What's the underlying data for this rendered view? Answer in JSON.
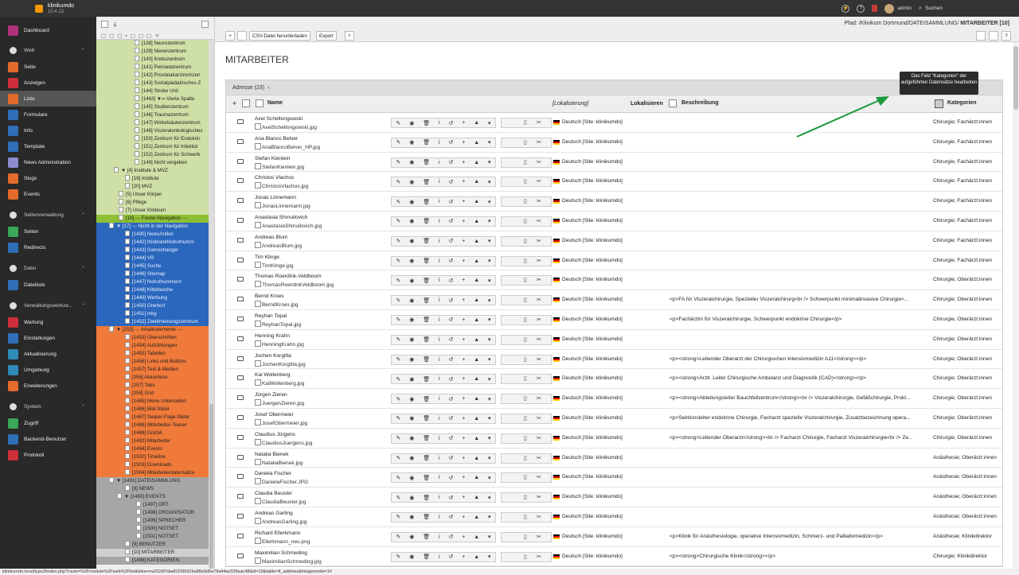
{
  "app": {
    "name": "klinikumdo",
    "version": "10.4.13",
    "user": "admin",
    "search_label": "Suchen"
  },
  "modules": [
    {
      "label": "Dashboard",
      "color": "#b0327d",
      "group": false
    },
    {
      "label": "Web",
      "color": "",
      "group": true
    },
    {
      "label": "Seite",
      "color": "#e46b2c",
      "group": false
    },
    {
      "label": "Anzeigen",
      "color": "#ce2f3a",
      "group": false
    },
    {
      "label": "Liste",
      "color": "#e46b2c",
      "group": false,
      "active": true
    },
    {
      "label": "Formulare",
      "color": "#2e6fb8",
      "group": false
    },
    {
      "label": "Info",
      "color": "#2e6fb8",
      "group": false
    },
    {
      "label": "Template",
      "color": "#2e6fb8",
      "group": false
    },
    {
      "label": "News Administration",
      "color": "#8b8ccf",
      "group": false
    },
    {
      "label": "Slugs",
      "color": "#e46b2c",
      "group": false
    },
    {
      "label": "Events",
      "color": "#e46b2c",
      "group": false
    },
    {
      "label": "Seitenverwaltung",
      "color": "",
      "group": true
    },
    {
      "label": "Seiten",
      "color": "#3aa858",
      "group": false
    },
    {
      "label": "Redirects",
      "color": "#2e6fb8",
      "group": false
    },
    {
      "label": "Datei",
      "color": "",
      "group": true
    },
    {
      "label": "Dateiliste",
      "color": "#2e6fb8",
      "group": false
    },
    {
      "label": "Verwaltungswerkze...",
      "color": "",
      "group": true
    },
    {
      "label": "Wartung",
      "color": "#ce2f3a",
      "group": false
    },
    {
      "label": "Einstellungen",
      "color": "#2e6fb8",
      "group": false
    },
    {
      "label": "Aktualisierung",
      "color": "#2e8bb8",
      "group": false
    },
    {
      "label": "Umgebung",
      "color": "#2e8bb8",
      "group": false
    },
    {
      "label": "Erweiterungen",
      "color": "#e46b2c",
      "group": false
    },
    {
      "label": "System",
      "color": "",
      "group": true
    },
    {
      "label": "Zugriff",
      "color": "#3aa858",
      "group": false
    },
    {
      "label": "Backend-Benutzer",
      "color": "#2e6fb8",
      "group": false
    },
    {
      "label": "Protokoll",
      "color": "#ce2f3a",
      "group": false
    }
  ],
  "tree": [
    {
      "t": "[138] Neurozentrum",
      "i": 48,
      "c": "#cfe0a6"
    },
    {
      "t": "[139] Nierenzentrum",
      "i": 48,
      "c": "#cfe0a6"
    },
    {
      "t": "[140] Krebszentrum",
      "i": 48,
      "c": "#cfe0a6"
    },
    {
      "t": "[141] Perinatalzentrum",
      "i": 48,
      "c": "#cfe0a6"
    },
    {
      "t": "[142] Prostatakarzinomzen",
      "i": 48,
      "c": "#cfe0a6"
    },
    {
      "t": "[143] Sozialpädiatrisches Z",
      "i": 48,
      "c": "#cfe0a6"
    },
    {
      "t": "[144] Stroke Unit",
      "i": 48,
      "c": "#cfe0a6"
    },
    {
      "t": "[1463] ▼═ Vierte Spalte",
      "i": 48,
      "c": "#cfe0a6"
    },
    {
      "t": "[145] Studienzentrum",
      "i": 48,
      "c": "#cfe0a6"
    },
    {
      "t": "[146] Traumazentrum",
      "i": 48,
      "c": "#cfe0a6"
    },
    {
      "t": "[147] Wirbelsäulenzentrum",
      "i": 48,
      "c": "#cfe0a6"
    },
    {
      "t": "[148] Viszeralonkologisches",
      "i": 48,
      "c": "#cfe0a6"
    },
    {
      "t": "[150] Zentrum für Endokrin",
      "i": 48,
      "c": "#cfe0a6"
    },
    {
      "t": "[151] Zentrum für Infektiol",
      "i": 48,
      "c": "#cfe0a6"
    },
    {
      "t": "[152] Zentrum für Schwerb",
      "i": 48,
      "c": "#cfe0a6"
    },
    {
      "t": "[149] Nicht vergeben",
      "i": 48,
      "c": "#cfe0a6"
    },
    {
      "t": "▼ [4] Institute & MVZ",
      "i": 22,
      "c": "#cfe0a6"
    },
    {
      "t": "[19] Institute",
      "i": 36,
      "c": "#cfe0a6"
    },
    {
      "t": "[20] MVZ",
      "i": 36,
      "c": "#cfe0a6"
    },
    {
      "t": "[5] Unser Körper",
      "i": 28,
      "c": "#cfe0a6"
    },
    {
      "t": "[6] Pflege",
      "i": 28,
      "c": "#cfe0a6"
    },
    {
      "t": "[7] Unser Klinikum",
      "i": 28,
      "c": "#cfe0a6"
    },
    {
      "t": "[18] --- Footer-Navigation ---",
      "i": 28,
      "c": "#8fbf34"
    },
    {
      "t": "▼ [17] --- Nicht in der Navigation",
      "i": 16,
      "c": "#2b67bd"
    },
    {
      "t": "[1490] NewsArtikel",
      "i": 36,
      "c": "#2b67bd"
    },
    {
      "t": "[1442] thinktankNotrufnumm",
      "i": 36,
      "c": "#2b67bd"
    },
    {
      "t": "[1443] Gamechanger",
      "i": 36,
      "c": "#2b67bd"
    },
    {
      "t": "[1444] VR",
      "i": 36,
      "c": "#2b67bd"
    },
    {
      "t": "[1445] Suche",
      "i": 36,
      "c": "#2b67bd"
    },
    {
      "t": "[1446] Sitemap",
      "i": 36,
      "c": "#2b67bd"
    },
    {
      "t": "[1447] Notrufnummern",
      "i": 36,
      "c": "#2b67bd"
    },
    {
      "t": "[1448] Kitteltasche",
      "i": 36,
      "c": "#2b67bd"
    },
    {
      "t": "[1449] Werbung",
      "i": 36,
      "c": "#2b67bd"
    },
    {
      "t": "[1450] Onehort",
      "i": 36,
      "c": "#2b67bd"
    },
    {
      "t": "[1451] mkg",
      "i": 36,
      "c": "#2b67bd"
    },
    {
      "t": "[1452] Zweitmeinungszentrum",
      "i": 36,
      "c": "#2b67bd"
    },
    {
      "t": "▼ [255] --- Inhaltselemente ---",
      "i": 16,
      "c": "#f07a3a"
    },
    {
      "t": "[1453] Überschriften",
      "i": 36,
      "c": "#f07a3a"
    },
    {
      "t": "[1454] Aufzählungen",
      "i": 36,
      "c": "#f07a3a"
    },
    {
      "t": "[1455] Tabellen",
      "i": 36,
      "c": "#f07a3a"
    },
    {
      "t": "[1456] Links und Buttons",
      "i": 36,
      "c": "#f07a3a"
    },
    {
      "t": "[1457] Text & Medien",
      "i": 36,
      "c": "#f07a3a"
    },
    {
      "t": "[256] Akkordeon",
      "i": 36,
      "c": "#f07a3a"
    },
    {
      "t": "[257] Tabs",
      "i": 36,
      "c": "#f07a3a"
    },
    {
      "t": "[258] Grid",
      "i": 36,
      "c": "#f07a3a"
    },
    {
      "t": "[1485] Menu Unterseiten",
      "i": 36,
      "c": "#f07a3a"
    },
    {
      "t": "[1486] Bild-Slider",
      "i": 36,
      "c": "#f07a3a"
    },
    {
      "t": "[1487] Swiper-Page-Slider",
      "i": 36,
      "c": "#f07a3a"
    },
    {
      "t": "[1488] Mitarbeiter-Teaser",
      "i": 36,
      "c": "#f07a3a"
    },
    {
      "t": "[1489] Grid34",
      "i": 36,
      "c": "#f07a3a"
    },
    {
      "t": "[1492] Mitarbeiter",
      "i": 36,
      "c": "#f07a3a"
    },
    {
      "t": "[1494] Events",
      "i": 36,
      "c": "#f07a3a"
    },
    {
      "t": "[1502] Timeline",
      "i": 36,
      "c": "#f07a3a"
    },
    {
      "t": "[1503] Downloads",
      "i": 36,
      "c": "#f07a3a"
    },
    {
      "t": "[1504] Mitarbeiterdatensätze",
      "i": 36,
      "c": "#f07a3a"
    },
    {
      "t": "▼ [1491] DATEISAMMLUNG",
      "i": 16,
      "c": "#a6a6a6"
    },
    {
      "t": "[8] NEWS",
      "i": 36,
      "c": "#a6a6a6"
    },
    {
      "t": "▼ [1493] EVENTS",
      "i": 26,
      "c": "#a6a6a6"
    },
    {
      "t": "[1497] ORT",
      "i": 50,
      "c": "#a6a6a6"
    },
    {
      "t": "[1498] ORGANISATOR",
      "i": 50,
      "c": "#a6a6a6"
    },
    {
      "t": "[1499] SPRECHER",
      "i": 50,
      "c": "#a6a6a6"
    },
    {
      "t": "[1500] NOTSET",
      "i": 50,
      "c": "#a6a6a6"
    },
    {
      "t": "[1501] NOTSET",
      "i": 50,
      "c": "#a6a6a6"
    },
    {
      "t": "[9] BENUTZER",
      "i": 36,
      "c": "#a6a6a6"
    },
    {
      "t": "[10] MITARBEITER",
      "i": 36,
      "c": "#d0d0d0"
    },
    {
      "t": "[1496] KATEGORIEN",
      "i": 36,
      "c": "#a6a6a6"
    }
  ],
  "docheader": {
    "csv_label": "CSV-Datei herunterladen",
    "export_label": "Export",
    "path_prefix": "Pfad: /Klinikum Dortmund/DATEISAMMLUNG/",
    "path_current": "MITARBEITER [10]"
  },
  "main": {
    "title": "MITARBEITER",
    "table_caption": "Adresse (23)",
    "col_name": "Name",
    "col_lokalisierung": "[Lokalisierung]",
    "col_lokalisieren": "Lokalisieren",
    "col_beschreibung": "Beschreibung",
    "col_kategorien": "Kategorien",
    "tooltip": "Das Feld \"Kategorien\" der aufgeführten Datensätze bearbeiten",
    "lang": "Deutsch [Site: klinikumdo]",
    "rows": [
      {
        "name": "Axel Schellongowski",
        "img": "AxelSchellongowski.jpg",
        "desc": "",
        "cat": "Chirurgie; Fachärzt:innen"
      },
      {
        "name": "Ana Blanco Belver",
        "img": "AnaBlancoBelver_HP.jpg",
        "desc": "",
        "cat": "Chirurgie; Fachärzt:innen"
      },
      {
        "name": "Stefan Kienlein",
        "img": "StefanKienlein.jpg",
        "desc": "",
        "cat": "Chirurgie; Fachärzt:innen"
      },
      {
        "name": "Christos Vlachos",
        "img": "ChristosVlachos.jpg",
        "desc": "",
        "cat": "Chirurgie; Fachärzt:innen"
      },
      {
        "name": "Jonas Linnemann",
        "img": "JonasLinnemann.jpg",
        "desc": "",
        "cat": "Chirurgie; Fachärzt:innen"
      },
      {
        "name": "Anastasia Shmuilovich",
        "img": "AnastasiaShmuilovich.jpg",
        "desc": "",
        "cat": "Chirurgie; Fachärzt:innen"
      },
      {
        "name": "Andreas Blum",
        "img": "AndreasBlum.jpg",
        "desc": "",
        "cat": "Chirurgie; Fachärzt:innen"
      },
      {
        "name": "Tim Klinge",
        "img": "TimKlinge.jpg",
        "desc": "",
        "cat": "Chirurgie; Fachärzt:innen"
      },
      {
        "name": "Thomas Roerdink-Veldboom",
        "img": "ThomasRoerdinkVeldboom.jpg",
        "desc": "",
        "cat": "Chirurgie; Oberärzt:innen"
      },
      {
        "name": "Bernd Kroes",
        "img": "BerndKroes.jpg",
        "desc": "<p>FA für Viszeralchirurgie, Spezieller Viszeralchirurg<br /> Schwerpunkt minimalinvasive Chirurgie<...",
        "cat": "Chirurgie; Oberärzt:innen"
      },
      {
        "name": "Reyhan Topal",
        "img": "ReyhanTopal.jpg",
        "desc": "<p>Fachärztin für Viszeralchirurgie, Schwerpunkt endokrine Chirurgie</p>",
        "cat": "Chirurgie; Oberärzt:innen"
      },
      {
        "name": "Henning Krahn",
        "img": "HenningKrahn.jpg",
        "desc": "",
        "cat": "Chirurgie; Oberärzt:innen"
      },
      {
        "name": "Jochen Korgitta",
        "img": "JochenKorgitta.jpg",
        "desc": "<p><strong>Leitender Oberarzt der Chirurgischen Intensivmedizin A11</strong></p>",
        "cat": "Chirurgie; Oberärzt:innen"
      },
      {
        "name": "Kai Wollenberg",
        "img": "KaiWollenberg.jpg",
        "desc": "<p><strong>Ärztl. Leiter Chirurgische Ambulanz und Diagnostik (CAD)</strong></p>",
        "cat": "Chirurgie; Oberärzt:innen"
      },
      {
        "name": "Jürgen Zieren",
        "img": "JuergenZieren.jpg",
        "desc": "<p><strong>Abteilungsleiter Bauchfellzentrum</strong><br /> Viszeralchirurgie, Gefäßchirurgie, Prokt...",
        "cat": "Chirurgie; Oberärzt:innen"
      },
      {
        "name": "Josef Obermeier",
        "img": "JosefObermeier.jpg",
        "desc": "<p>Sektionsleiter endokrine Chirurgie, Facharzt spezielle Viszeralchirurgie, Zusatzbezeichnung opera...",
        "cat": "Chirurgie; Oberärzt:innen"
      },
      {
        "name": "Claudius Jürgens",
        "img": "ClaudiusJuergens.jpg",
        "desc": "<p><strong>Leitender Oberarzt</strong><br /> Facharzt Chirurgie, Facharzt Viszeralchirurgie<br /> Ze...",
        "cat": "Chirurgie; Oberärzt:innen"
      },
      {
        "name": "Natalia Bienek",
        "img": "NataliaBienek.jpg",
        "desc": "",
        "cat": "Anästhesie; Oberärzt:innen"
      },
      {
        "name": "Daniela Fischer",
        "img": "DanielaFischer.JPG",
        "desc": "",
        "cat": "Anästhesie; Oberärzt:innen"
      },
      {
        "name": "Claudia Beuster",
        "img": "ClaudiaBeuster.jpg",
        "desc": "",
        "cat": "Anästhesie; Oberärzt:innen"
      },
      {
        "name": "Andreas Garling",
        "img": "AndreasGarling.jpg",
        "desc": "",
        "cat": "Anästhesie; Oberärzt:innen"
      },
      {
        "name": "Richard Ellerkmann",
        "img": "Ellerkmann_neu.png",
        "desc": "<p>Klinik für Anästhesiologie, operative Intensivmedizin, Schmerz- und Palliativmedizin</p>",
        "cat": "Anästhesie; Klinikdirektor"
      },
      {
        "name": "Maximilian Schmeding",
        "img": "MaximilianSchmeding.jpg",
        "desc": "<p><strong>Chirurgische Klinik</strong></p>",
        "cat": "Chirurgie; Klinikdirektor"
      }
    ]
  },
  "statusbar": "klinikumdo.local/typo3/index.php?route=%2Fmodule%2Fweb%2Flist&token=a202df7dad0339692ba88a9d0a79a44ac028aac48&id=10&table=tt_address&imagemode=1#"
}
